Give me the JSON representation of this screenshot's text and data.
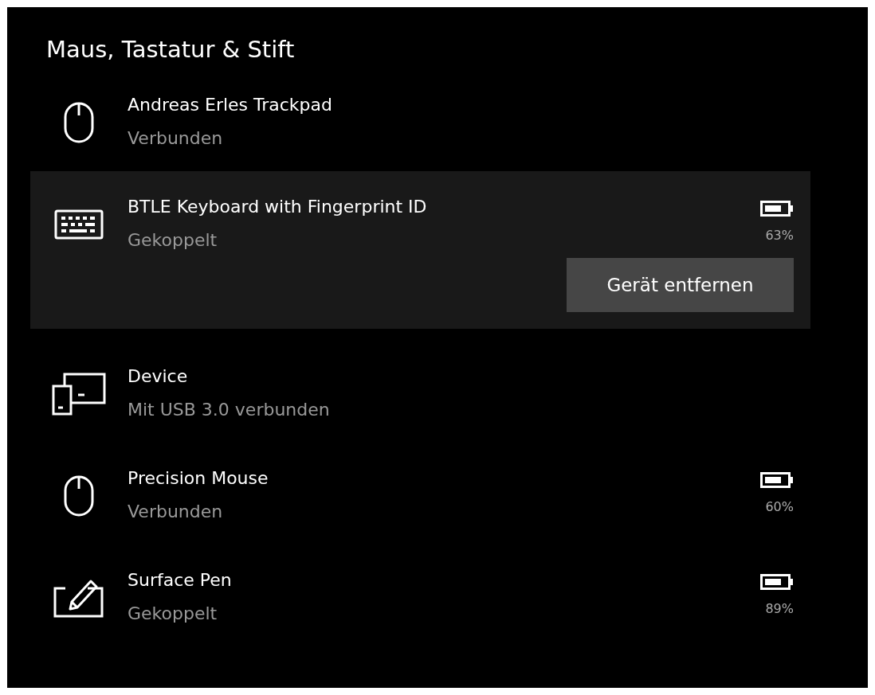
{
  "section": {
    "title": "Maus, Tastatur & Stift"
  },
  "devices": [
    {
      "kind": "mouse",
      "name": "Andreas Erles Trackpad",
      "status": "Verbunden",
      "selected": false
    },
    {
      "kind": "keyboard",
      "name": "BTLE Keyboard with Fingerprint ID",
      "status": "Gekoppelt",
      "battery": "63%",
      "selected": true,
      "action": "Gerät entfernen"
    },
    {
      "kind": "device",
      "name": "Device",
      "status": "Mit USB 3.0 verbunden",
      "selected": false
    },
    {
      "kind": "mouse",
      "name": "Precision Mouse",
      "status": "Verbunden",
      "battery": "60%",
      "selected": false
    },
    {
      "kind": "pen",
      "name": "Surface Pen",
      "status": "Gekoppelt",
      "battery": "89%",
      "selected": false
    }
  ]
}
